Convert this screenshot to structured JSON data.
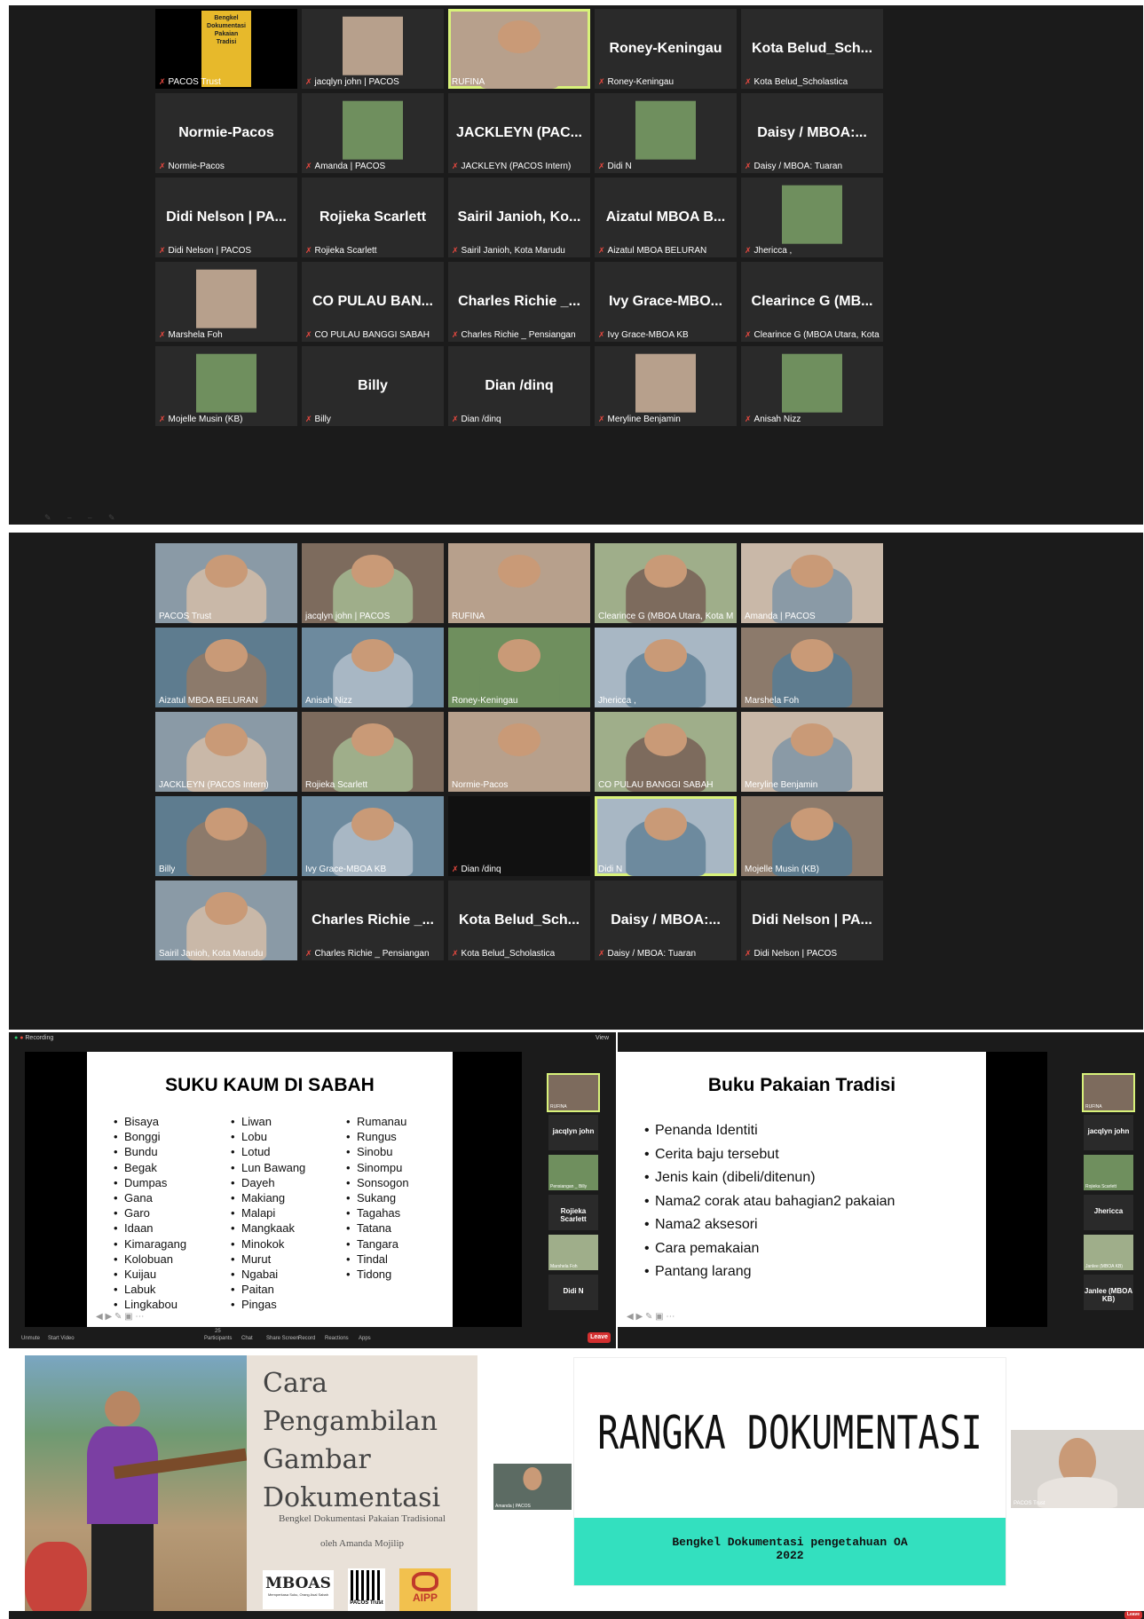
{
  "panel1": {
    "tiles": [
      {
        "big": "",
        "label": "PACOS Trust",
        "kind": "poster",
        "poster": [
          "Bengkel",
          "Dokumentasi",
          "Pakaian",
          "Tradisi"
        ]
      },
      {
        "big": "",
        "label": "jacqlyn john | PACOS",
        "kind": "image"
      },
      {
        "big": "",
        "label": "RUFINA",
        "kind": "video",
        "active": true
      },
      {
        "big": "Roney-Keningau",
        "label": "Roney-Keningau"
      },
      {
        "big": "Kota Belud_Sch...",
        "label": "Kota Belud_Scholastica"
      },
      {
        "big": "Normie-Pacos",
        "label": "Normie-Pacos"
      },
      {
        "big": "",
        "label": "Amanda | PACOS",
        "kind": "image"
      },
      {
        "big": "JACKLEYN (PAC...",
        "label": "JACKLEYN (PACOS Intern)"
      },
      {
        "big": "",
        "label": "Didi N",
        "kind": "image"
      },
      {
        "big": "Daisy / MBOA:...",
        "label": "Daisy / MBOA: Tuaran"
      },
      {
        "big": "Didi Nelson | PA...",
        "label": "Didi Nelson | PACOS"
      },
      {
        "big": "Rojieka Scarlett",
        "label": "Rojieka Scarlett"
      },
      {
        "big": "Sairil Janioh, Ko...",
        "label": "Sairil Janioh, Kota Marudu"
      },
      {
        "big": "Aizatul MBOA B...",
        "label": "Aizatul MBOA BELURAN"
      },
      {
        "big": "",
        "label": "Jhericca ,",
        "kind": "image"
      },
      {
        "big": "",
        "label": "Marshela Foh",
        "kind": "image"
      },
      {
        "big": "CO PULAU BAN...",
        "label": "CO PULAU BANGGI SABAH"
      },
      {
        "big": "Charles Richie _...",
        "label": "Charles Richie _ Pensiangan"
      },
      {
        "big": "Ivy Grace-MBO...",
        "label": "Ivy Grace-MBOA KB"
      },
      {
        "big": "Clearince G (MB...",
        "label": "Clearince G (MBOA Utara, Kota Ma..."
      },
      {
        "big": "",
        "label": "Mojelle Musin (KB)",
        "kind": "image"
      },
      {
        "big": "Billy",
        "label": "Billy"
      },
      {
        "big": "Dian /dinq",
        "label": "Dian /dinq"
      },
      {
        "big": "",
        "label": "Meryline Benjamin",
        "kind": "image"
      },
      {
        "big": "",
        "label": "Anisah Nizz",
        "kind": "image"
      }
    ]
  },
  "panel2": {
    "tiles": [
      {
        "big": "",
        "label": "PACOS Trust",
        "kind": "video"
      },
      {
        "big": "",
        "label": "jacqlyn john | PACOS",
        "kind": "video"
      },
      {
        "big": "",
        "label": "RUFINA",
        "kind": "video"
      },
      {
        "big": "",
        "label": "Clearince G (MBOA Utara, Kota Ma...",
        "kind": "video"
      },
      {
        "big": "",
        "label": "Amanda | PACOS",
        "kind": "video"
      },
      {
        "big": "",
        "label": "Aizatul MBOA BELURAN",
        "kind": "video"
      },
      {
        "big": "",
        "label": "Anisah Nizz",
        "kind": "video"
      },
      {
        "big": "",
        "label": "Roney-Keningau",
        "kind": "video"
      },
      {
        "big": "",
        "label": "Jhericca ,",
        "kind": "video"
      },
      {
        "big": "",
        "label": "Marshela Foh",
        "kind": "video"
      },
      {
        "big": "",
        "label": "JACKLEYN (PACOS Intern)",
        "kind": "video"
      },
      {
        "big": "",
        "label": "Rojieka Scarlett",
        "kind": "video"
      },
      {
        "big": "",
        "label": "Normie-Pacos",
        "kind": "video"
      },
      {
        "big": "",
        "label": "CO PULAU BANGGI SABAH",
        "kind": "video"
      },
      {
        "big": "",
        "label": "Meryline Benjamin",
        "kind": "video"
      },
      {
        "big": "",
        "label": "Billy",
        "kind": "video"
      },
      {
        "big": "",
        "label": "Ivy Grace-MBOA KB",
        "kind": "video"
      },
      {
        "big": "",
        "label": "Dian /dinq",
        "kind": "dark"
      },
      {
        "big": "",
        "label": "Didi N",
        "kind": "video",
        "active": true
      },
      {
        "big": "",
        "label": "Mojelle Musin (KB)",
        "kind": "video"
      },
      {
        "big": "",
        "label": "Sairil Janioh, Kota Marudu",
        "kind": "video"
      },
      {
        "big": "Charles Richie _...",
        "label": "Charles Richie _ Pensiangan"
      },
      {
        "big": "Kota Belud_Sch...",
        "label": "Kota Belud_Scholastica"
      },
      {
        "big": "Daisy / MBOA:...",
        "label": "Daisy / MBOA: Tuaran"
      },
      {
        "big": "Didi Nelson | PA...",
        "label": "Didi Nelson | PACOS"
      }
    ]
  },
  "panel3": {
    "recording": "Recording",
    "view": "View",
    "slide_title": "SUKU KAUM DI SABAH",
    "col1": [
      "Bisaya",
      "Bonggi",
      "Bundu",
      "Begak",
      "Dumpas",
      "Gana",
      "Garo",
      "Idaan",
      "Kimaragang",
      "Kolobuan",
      "Kuijau",
      "Labuk",
      "Lingkabou"
    ],
    "col2": [
      "Liwan",
      "Lobu",
      "Lotud",
      "Lun Bawang",
      "Dayeh",
      "Makiang",
      "Malapi",
      "Mangkaak",
      "Minokok",
      "Murut",
      "Ngabai",
      "Paitan",
      "Pingas"
    ],
    "col3": [
      "Rumanau",
      "Rungus",
      "Sinobu",
      "Sinompu",
      "Sonsogon",
      "Sukang",
      "Tagahas",
      "Tatana",
      "Tangara",
      "Tindal",
      "Tidong"
    ],
    "side": [
      "RUFINA",
      "jacqlyn john",
      "Pensiangan _ Billy",
      "Rojieka Scarlett",
      "Marshela Foh",
      "Didi N"
    ],
    "toolbar": [
      "Unmute",
      "Start Video",
      "Participants",
      "Chat",
      "Share Screen",
      "Record",
      "Reactions",
      "Apps"
    ],
    "participants_count": "25"
  },
  "panel4": {
    "slide_title": "Buku Pakaian Tradisi",
    "bullets": [
      "Penanda Identiti",
      "Cerita baju tersebut",
      "Jenis kain (dibeli/ditenun)",
      "Nama2 corak atau bahagian2 pakaian",
      "Nama2 aksesori",
      "Cara pemakaian",
      "Pantang larang"
    ],
    "side": [
      "RUFINA",
      "jacqlyn john",
      "Rojieka Scarlett",
      "Jhericca",
      "Janlee (MBOA KB)",
      "Janlee (MBOA KB)"
    ],
    "leave": "Leave"
  },
  "panel5": {
    "title_lines": [
      "Cara",
      "Pengambilan",
      "Gambar",
      "Dokumentasi"
    ],
    "subtitle": "Bengkel Dokumentasi Pakaian Tradisional",
    "byline": "oleh Amanda Mojilip",
    "logos": [
      "MBOAS",
      "PACOS Trust",
      "AIPP"
    ],
    "mboas_tagline": "Memperkasa Suku, Orang Asal Sabah",
    "side_label": "Amanda | PACOS"
  },
  "panel6": {
    "title": "RANGKA DOKUMENTASI",
    "banner_line1": "Bengkel Dokumentasi pengetahuan OA",
    "banner_line2": "2022",
    "banner_color": "#33e0bf",
    "side_label": "PACOS Trust",
    "leave": "Leave"
  }
}
